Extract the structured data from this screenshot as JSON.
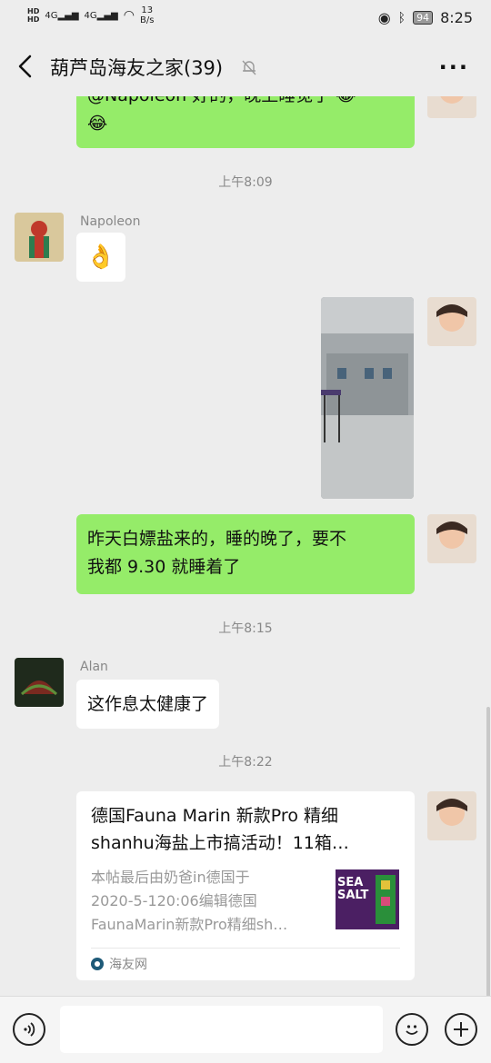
{
  "status_bar": {
    "hd1": "HD",
    "hd2": "HD",
    "signal1": "4G",
    "signal2": "4G",
    "net_speed_value": "13",
    "net_speed_unit": "B/s",
    "battery": "94",
    "time": "8:25"
  },
  "header": {
    "title": "葫芦岛海友之家(39)"
  },
  "messages": [
    {
      "type": "text",
      "text": "@Napoleon 好的，晚上睡觉了"
    },
    {
      "type": "time",
      "text": "上午8:09"
    },
    {
      "type": "sender",
      "text": "Napoleon"
    },
    {
      "type": "emoji",
      "text": "👌"
    },
    {
      "type": "text",
      "text": "昨天白嫖盐来的，睡的晚了，要不"
    },
    {
      "type": "text",
      "text": "我都 9.30 就睡着了"
    },
    {
      "type": "time",
      "text": "上午8:15"
    },
    {
      "type": "sender",
      "text": "Alan"
    },
    {
      "type": "text",
      "text": "这作息太健康了"
    },
    {
      "type": "time",
      "text": "上午8:22"
    }
  ],
  "link_card": {
    "title_line1": "德国Fauna Marin 新款Pro 精细",
    "title_line2": "shanhu海盐上市搞活动！11箱…",
    "desc_line1": "本帖最后由奶爸in德国于",
    "desc_line2": "2020-5-120:06编辑德国",
    "desc_line3": "FaunaMarin新款Pro精细sh…",
    "source": "海友网",
    "thumb_text": "SEA SALT"
  },
  "colors": {
    "bubble_self": "#95ec69",
    "background": "#ededed"
  }
}
